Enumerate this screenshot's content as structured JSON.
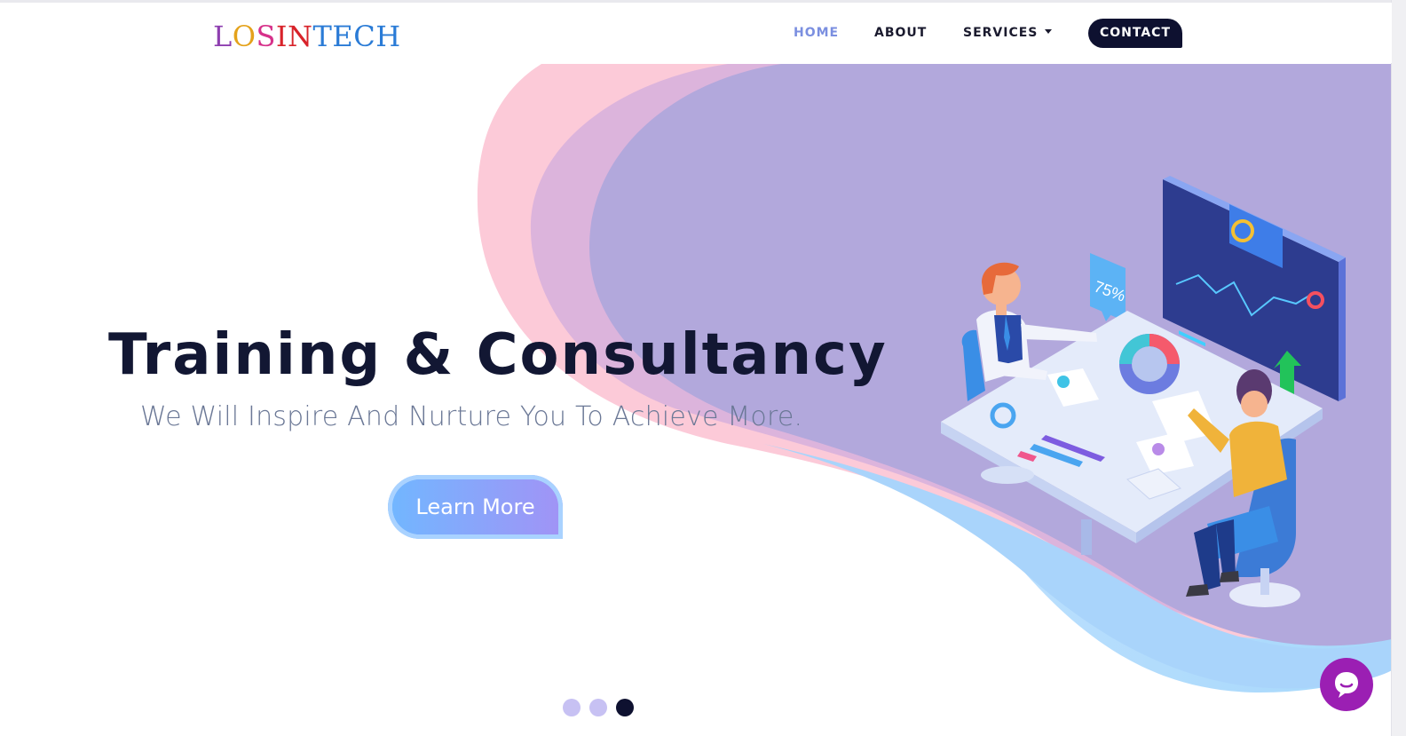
{
  "brand": {
    "logo_letters": [
      {
        "char": "L",
        "color": "#8e3fb0"
      },
      {
        "char": "O",
        "color": "#e4a21b"
      },
      {
        "char": "S",
        "color": "#d6318a"
      },
      {
        "char": "I",
        "color": "#d8232a"
      },
      {
        "char": "N",
        "color": "#d8232a"
      },
      {
        "char": "T",
        "color": "#2a7bd6"
      },
      {
        "char": "E",
        "color": "#2a7bd6"
      },
      {
        "char": "C",
        "color": "#2a7bd6"
      },
      {
        "char": "H",
        "color": "#2a7bd6"
      }
    ]
  },
  "nav": {
    "home": "HOME",
    "about": "ABOUT",
    "services": "SERVICES",
    "contact": "CONTACT"
  },
  "hero": {
    "title": "Training & Consultancy",
    "subtitle": "We Will Inspire And Nurture You To Achieve More.",
    "cta_label": "Learn More",
    "illustration_label": "75%"
  },
  "carousel": {
    "slide_count": 3,
    "active_slide": 3
  },
  "colors": {
    "accent": "#7b8fe0",
    "dark": "#0e1130",
    "chat": "#9b1fb3"
  },
  "icons": {
    "chat": "chat-bubble-icon",
    "caret": "caret-down-icon"
  }
}
